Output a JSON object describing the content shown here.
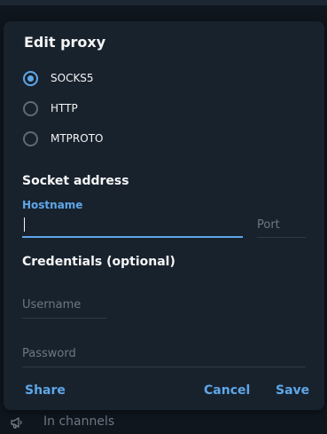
{
  "dialog": {
    "title": "Edit proxy",
    "proxy_types": [
      {
        "label": "SOCKS5",
        "checked": true
      },
      {
        "label": "HTTP",
        "checked": false
      },
      {
        "label": "MTPROTO",
        "checked": false
      }
    ],
    "socket_section_title": "Socket address",
    "hostname": {
      "label": "Hostname",
      "value": ""
    },
    "port": {
      "placeholder": "Port",
      "value": ""
    },
    "credentials_title": "Credentials (optional)",
    "username": {
      "placeholder": "Username",
      "value": ""
    },
    "password": {
      "placeholder": "Password",
      "value": ""
    },
    "buttons": {
      "share": "Share",
      "cancel": "Cancel",
      "save": "Save"
    }
  },
  "background": {
    "row_label": "In channels",
    "row_icon": "megaphone-icon"
  },
  "colors": {
    "accent": "#5ea7e8",
    "dialog_bg": "#18222d",
    "text": "#f5f5f5",
    "muted": "#6d7883"
  }
}
